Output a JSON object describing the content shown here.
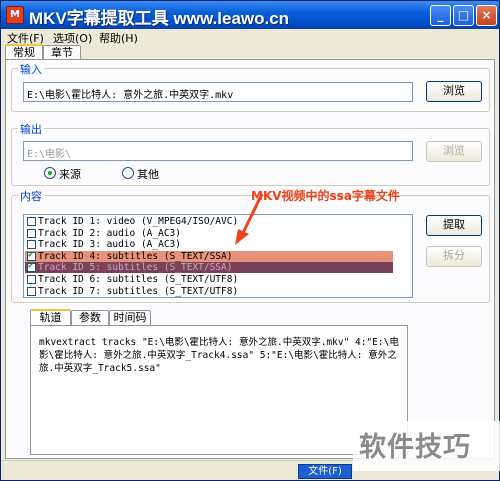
{
  "window": {
    "title": "MKV字幕提取工具 www.leawo.cn",
    "app_icon_glyph": "M",
    "controls": {
      "minimize": "_",
      "maximize": "□",
      "close": "×"
    }
  },
  "menu": [
    "文件(F)",
    "选项(O)",
    "帮助(H)"
  ],
  "top_tabs": [
    "常规",
    "章节"
  ],
  "input_group": {
    "label": "输入",
    "path": "E:\\电影\\霍比特人: 意外之旅.中英双字.mkv",
    "browse_label": "浏览"
  },
  "output_group": {
    "label": "输出",
    "path": "E:\\电影\\",
    "browse_label": "浏览",
    "radio_source_label": "来源",
    "radio_other_label": "其他"
  },
  "content_group": {
    "label": "内容",
    "annotation": "MKV视频中的ssa字幕文件",
    "extract_label": "提取",
    "split_label": "拆分",
    "tracks": [
      {
        "text": "Track ID 1: video (V_MPEG4/ISO/AVC)",
        "checked": false
      },
      {
        "text": "Track ID 2: audio (A_AC3)",
        "checked": false
      },
      {
        "text": "Track ID 3: audio (A_AC3)",
        "checked": false
      },
      {
        "text": "Track ID 4: subtitles (S_TEXT/SSA)",
        "checked": true
      },
      {
        "text": "Track ID 5: subtitles (S_TEXT/SSA)",
        "checked": true
      },
      {
        "text": "Track ID 6: subtitles (S_TEXT/UTF8)",
        "checked": false
      },
      {
        "text": "Track ID 7: subtitles (S_TEXT/UTF8)",
        "checked": false
      }
    ]
  },
  "bottom_tabs": [
    "轨道",
    "参数",
    "时间码"
  ],
  "command_text": "mkvextract tracks \"E:\\电影\\霍比特人: 意外之旅.中英双字.mkv\" 4:\"E:\\电影\\霍比特人: 意外之旅.中英双字_Track4.ssa\" 5:\"E:\\电影\\霍比特人: 意外之旅.中英双字_Track5.ssa\"",
  "status": {
    "file_button": "文件(F)"
  },
  "watermark": "软件技巧",
  "colors": {
    "title_bar": "#0a5fd8",
    "selected_row_1": "#e6917a",
    "selected_row_2": "#7a4258",
    "annotation": "#f0421a",
    "group_label": "#0046d5"
  }
}
